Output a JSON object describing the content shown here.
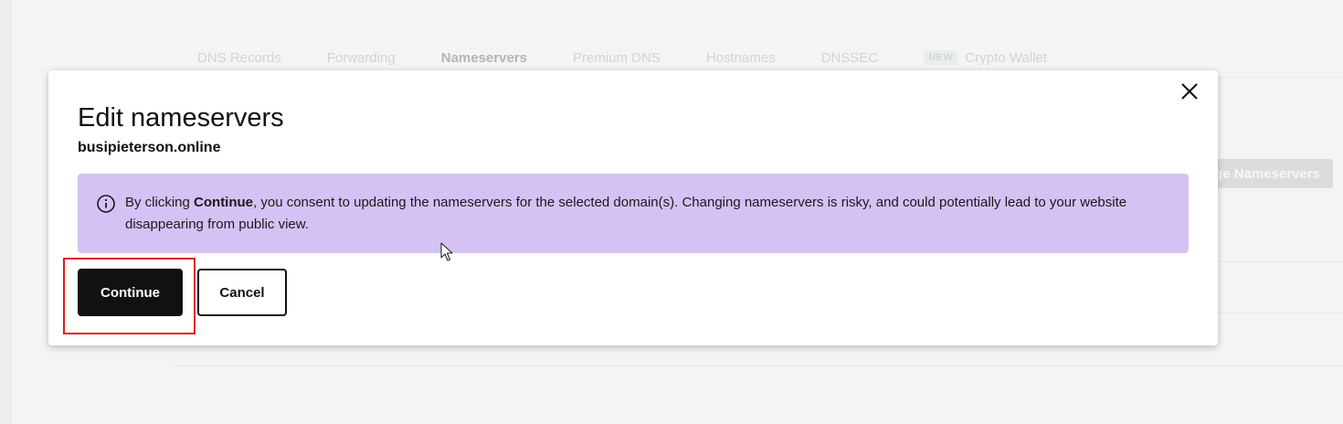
{
  "background": {
    "tabs": [
      {
        "label": "DNS Records",
        "active": false
      },
      {
        "label": "Forwarding",
        "active": false
      },
      {
        "label": "Nameservers",
        "active": true
      },
      {
        "label": "Premium DNS",
        "active": false
      },
      {
        "label": "Hostnames",
        "active": false
      },
      {
        "label": "DNSSEC",
        "active": false
      },
      {
        "label": "Crypto Wallet",
        "active": false,
        "badge": "NEW"
      }
    ],
    "change_nameservers_label": "ge Nameservers"
  },
  "modal": {
    "title": "Edit nameservers",
    "domain": "busipieterson.online",
    "alert": {
      "icon": "info-icon",
      "prefix": "By clicking ",
      "emphasis": "Continue",
      "suffix": ", you consent to updating the nameservers for the selected domain(s). Changing nameservers is risky, and could potentially lead to your website disappearing from public view."
    },
    "continue_label": "Continue",
    "cancel_label": "Cancel",
    "close_icon": "close-icon"
  },
  "colors": {
    "alert_bg": "#d4c2f5",
    "primary_button": "#111111",
    "highlight": "#e01b1b"
  }
}
